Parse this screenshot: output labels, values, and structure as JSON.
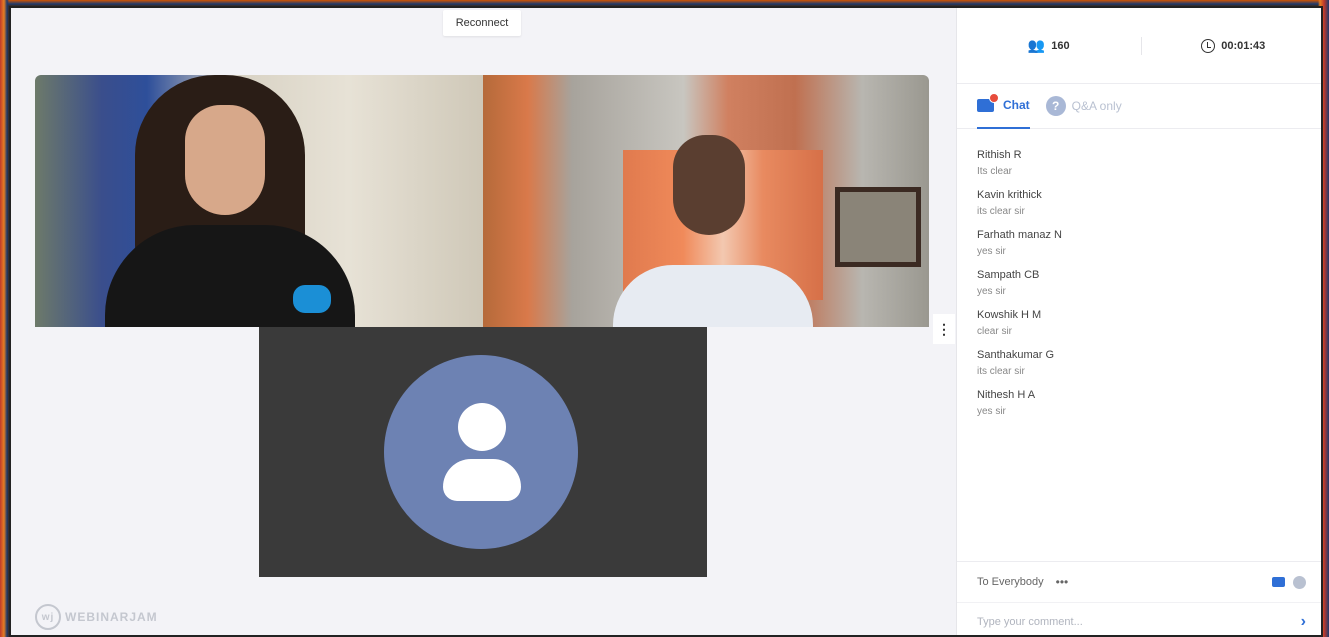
{
  "stage": {
    "reconnect_label": "Reconnect",
    "brand_name": "WEBINARJAM",
    "more_options_icon": "more-vertical-icon"
  },
  "panel": {
    "attendee_count": "160",
    "elapsed_time": "00:01:43",
    "tabs": [
      {
        "label": "Chat",
        "active": true
      },
      {
        "label": "Q&A only",
        "active": false
      }
    ],
    "qa_icon_text": "?",
    "messages": [
      {
        "name": "Rithish R",
        "text": "Its clear"
      },
      {
        "name": "Kavin krithick",
        "text": "its clear sir"
      },
      {
        "name": "Farhath manaz N",
        "text": "yes sir"
      },
      {
        "name": "Sampath CB",
        "text": "yes sir"
      },
      {
        "name": "Kowshik H M",
        "text": "clear sir"
      },
      {
        "name": "Santhakumar G",
        "text": "its clear sir"
      },
      {
        "name": "Nithesh H A",
        "text": "yes sir"
      }
    ],
    "compose": {
      "to_label": "To Everybody",
      "to_dots": "•••",
      "placeholder": "Type your comment..."
    }
  },
  "colors": {
    "accent": "#2f6fd6",
    "notification": "#e74c3c",
    "avatar_bg": "#6d82b3"
  }
}
